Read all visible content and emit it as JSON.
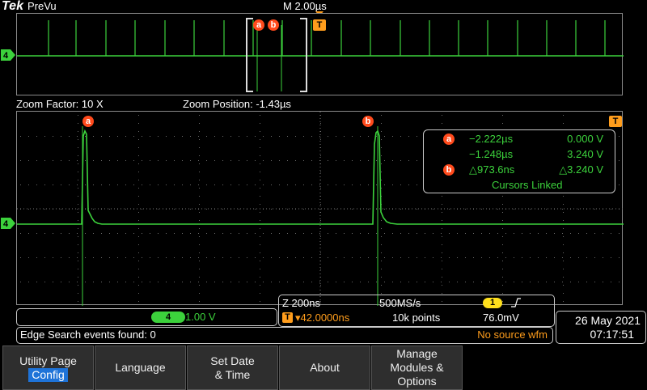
{
  "header": {
    "brand": "Tek",
    "mode": "PreVu",
    "timebase": "M 2.00µs",
    "trigger_marker": "T"
  },
  "colors": {
    "trace": "#3cd23c",
    "cursor_badge": "#ff4a1c",
    "trigger": "#ff9d1c",
    "accent_blue": "#1e73d8"
  },
  "channel": {
    "number": "4",
    "scale": "1.00 V"
  },
  "zoom": {
    "factor_label": "Zoom Factor: 10 X",
    "position_label": "Zoom Position: -1.43µs"
  },
  "cursors": {
    "a_label": "a",
    "b_label": "b",
    "a_time": "−2.222µs",
    "a_volt": "0.000 V",
    "b_time": "−1.248µs",
    "b_volt": "3.240 V",
    "delta_time": "△973.6ns",
    "delta_volt": "△3.240 V",
    "linked": "Cursors Linked"
  },
  "acquisition": {
    "zoom_scale": "Z 200ns",
    "sample_rate": "500MS/s",
    "trigger_channel": "1",
    "trigger_offset": "▾42.0000ns",
    "record_length": "10k points",
    "trigger_level": "76.0mV"
  },
  "status": {
    "search": "Edge Search events found: 0",
    "warning": "No source wfm"
  },
  "datetime": {
    "date": "26 May 2021",
    "time": "07:17:51"
  },
  "menu": [
    {
      "line1": "Utility Page",
      "line2": "Config"
    },
    {
      "line1": "Language",
      "line2": ""
    },
    {
      "line1": "Set Date",
      "line2": "& Time"
    },
    {
      "line1": "About",
      "line2": ""
    },
    {
      "line1": "Manage",
      "line2": "Modules &",
      "line3": "Options"
    }
  ]
}
